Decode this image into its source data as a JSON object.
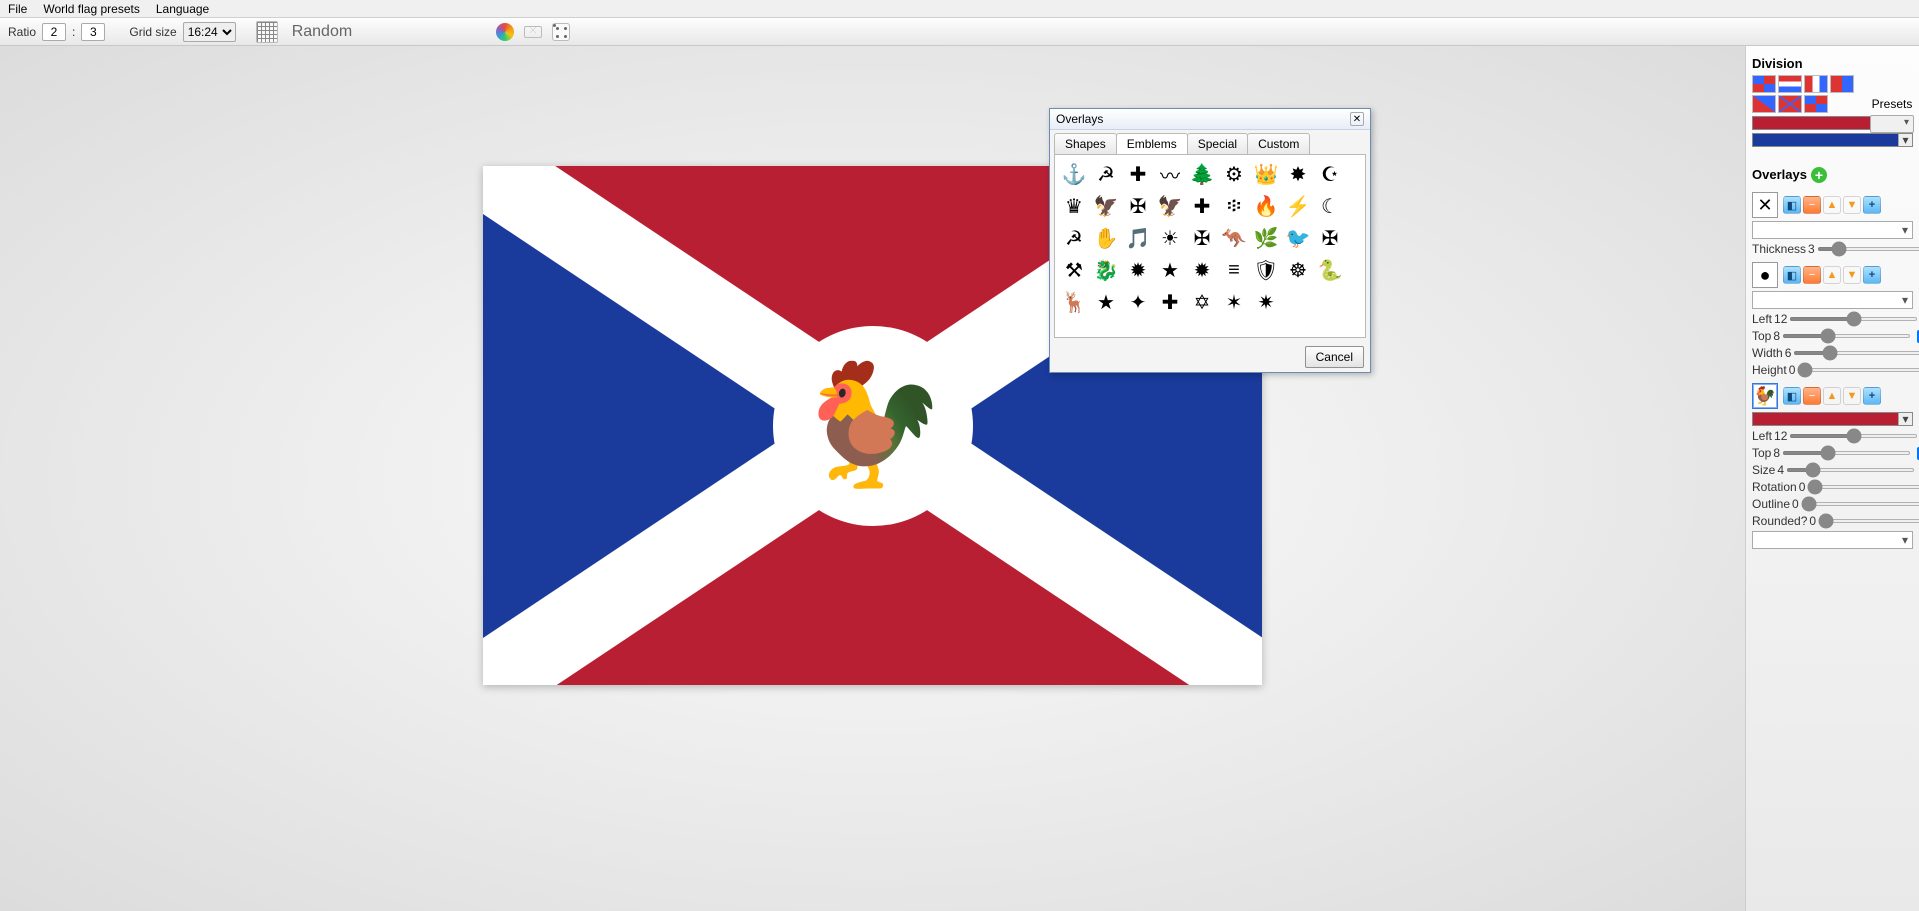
{
  "menu": {
    "file": "File",
    "presets": "World flag presets",
    "language": "Language"
  },
  "toolbar": {
    "ratio_label": "Ratio",
    "ratio_a": "2",
    "ratio_sep": ":",
    "ratio_b": "3",
    "grid_label": "Grid size",
    "grid_value": "16:24",
    "random": "Random"
  },
  "dialog": {
    "title": "Overlays",
    "tabs": {
      "shapes": "Shapes",
      "emblems": "Emblems",
      "special": "Special",
      "custom": "Custom"
    },
    "active_tab": "Emblems",
    "cancel": "Cancel",
    "emblems": [
      "⚓",
      "☭",
      "✚",
      "〰",
      "🌲",
      "⚙",
      "👑",
      "✸",
      "☪",
      "♛",
      "🦅",
      "✠",
      "🦅",
      "✚",
      "፨",
      "🔥",
      "⚡",
      "☾",
      "☭",
      "✋",
      "🎵",
      "☀",
      "✠",
      "🦘",
      "🌿",
      "🐦",
      "✠",
      "⚒",
      "🐉",
      "✹",
      "★",
      "✹",
      "≡",
      "🛡",
      "☸",
      "🐍",
      "🦌",
      "★",
      "✦",
      "✚",
      "✡",
      "✶",
      "✷"
    ]
  },
  "sidebar": {
    "division_title": "Division",
    "presets_label": "Presets",
    "colors": {
      "c1": "#b91f33",
      "c2": "#1a3a9c"
    },
    "overlays_title": "Overlays",
    "blocks": [
      {
        "thumb": "✕",
        "selected": false,
        "select": "",
        "props": [
          {
            "label": "Thickness",
            "value": "3",
            "checked": true
          }
        ]
      },
      {
        "thumb": "●",
        "selected": false,
        "select": "",
        "props": [
          {
            "label": "Left",
            "value": "12",
            "checked": true
          },
          {
            "label": "Top",
            "value": "8",
            "checked": true
          },
          {
            "label": "Width",
            "value": "6",
            "checked": true
          },
          {
            "label": "Height",
            "value": "0",
            "checked": true
          }
        ]
      },
      {
        "thumb": "🐓",
        "selected": true,
        "color": "#b91f33",
        "props": [
          {
            "label": "Left",
            "value": "12",
            "checked": true
          },
          {
            "label": "Top",
            "value": "8",
            "checked": true
          },
          {
            "label": "Size",
            "value": "4",
            "checked": true
          },
          {
            "label": "Rotation",
            "value": "0",
            "checked": true
          },
          {
            "label": "Outline",
            "value": "0",
            "checked": true
          },
          {
            "label": "Rounded?",
            "value": "0",
            "checked": true
          }
        ],
        "select": ""
      }
    ]
  }
}
